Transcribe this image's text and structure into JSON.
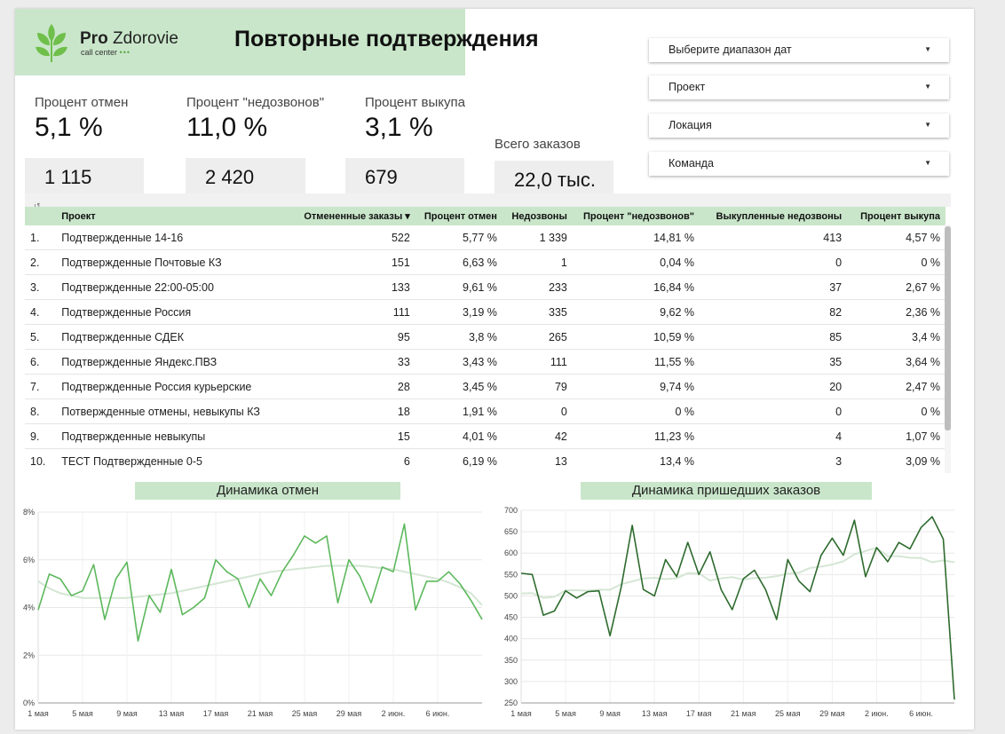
{
  "header": {
    "logo_word_bold": "Pro",
    "logo_word_light": "Zdorovie",
    "logo_sub": "call center",
    "logo_dots": "•••",
    "title": "Повторные подтверждения"
  },
  "filters": [
    {
      "label": "Выберите диапазон дат"
    },
    {
      "label": "Проект"
    },
    {
      "label": "Локация"
    },
    {
      "label": "Команда"
    }
  ],
  "kpis": {
    "cancel": {
      "label": "Процент отмен",
      "value": "5,1 %",
      "count": "1 115"
    },
    "nocall": {
      "label": "Процент \"недозвонов\"",
      "value": "11,0 %",
      "count": "2 420"
    },
    "buyout": {
      "label": "Процент выкупа",
      "value": "3,1 %",
      "count": "679"
    },
    "total": {
      "label": "Всего заказов",
      "value": "22,0 тыс."
    }
  },
  "table": {
    "headers": [
      "",
      "Проект",
      "Отмененные заказы ▾",
      "Процент отмен",
      "Недозвоны",
      "Процент \"недозвонов\"",
      "Выкупленные недозвоны",
      "Процент выкупа"
    ],
    "rows": [
      [
        "1.",
        "Подтвержденные 14-16",
        "522",
        "5,77 %",
        "1 339",
        "14,81 %",
        "413",
        "4,57 %"
      ],
      [
        "2.",
        "Подтвержденные Почтовые КЗ",
        "151",
        "6,63 %",
        "1",
        "0,04 %",
        "0",
        "0 %"
      ],
      [
        "3.",
        "Подтвержденные 22:00-05:00",
        "133",
        "9,61 %",
        "233",
        "16,84 %",
        "37",
        "2,67 %"
      ],
      [
        "4.",
        "Подтвержденные Россия",
        "111",
        "3,19 %",
        "335",
        "9,62 %",
        "82",
        "2,36 %"
      ],
      [
        "5.",
        "Подтвержденные СДЕК",
        "95",
        "3,8 %",
        "265",
        "10,59 %",
        "85",
        "3,4 %"
      ],
      [
        "6.",
        "Подтвержденные Яндекс.ПВЗ",
        "33",
        "3,43 %",
        "111",
        "11,55 %",
        "35",
        "3,64 %"
      ],
      [
        "7.",
        "Подтвержденные Россия курьерские",
        "28",
        "3,45 %",
        "79",
        "9,74 %",
        "20",
        "2,47 %"
      ],
      [
        "8.",
        "Потвержденные отмены, невыкупы КЗ",
        "18",
        "1,91 %",
        "0",
        "0 %",
        "0",
        "0 %"
      ],
      [
        "9.",
        "Подтвержденные невыкупы",
        "15",
        "4,01 %",
        "42",
        "11,23 %",
        "4",
        "1,07 %"
      ],
      [
        "10.",
        "ТЕСТ Подтвержденные 0-5",
        "6",
        "6,19 %",
        "13",
        "13,4 %",
        "3",
        "3,09 %"
      ]
    ]
  },
  "chart_data": [
    {
      "type": "line",
      "title": "Динамика отмен",
      "x_tick_labels": [
        "1 мая",
        "5 мая",
        "9 мая",
        "13 мая",
        "17 мая",
        "21 мая",
        "25 мая",
        "29 мая",
        "2 июн.",
        "6 июн."
      ],
      "y_tick_labels": [
        "0%",
        "2%",
        "4%",
        "6%",
        "8%"
      ],
      "ylim": [
        0,
        8
      ],
      "grid": true,
      "color": "#5cb85c",
      "trend_color": "#d4e6d4",
      "values": [
        3.9,
        5.4,
        5.2,
        4.5,
        4.7,
        5.8,
        3.5,
        5.2,
        5.9,
        2.6,
        4.5,
        3.8,
        5.6,
        3.7,
        4.0,
        4.4,
        6.0,
        5.5,
        5.2,
        4.0,
        5.2,
        4.5,
        5.5,
        6.2,
        7.0,
        6.7,
        7.0,
        4.2,
        6.0,
        5.3,
        4.2,
        5.7,
        5.5,
        7.5,
        3.9,
        5.1,
        5.1,
        5.5,
        5.0,
        4.3,
        3.5
      ],
      "trend": [
        5.1,
        4.8,
        4.6,
        4.5,
        4.4,
        4.4,
        4.4,
        4.4,
        4.4,
        4.45,
        4.5,
        4.55,
        4.6,
        4.7,
        4.8,
        4.9,
        5.0,
        5.1,
        5.2,
        5.3,
        5.4,
        5.5,
        5.55,
        5.6,
        5.65,
        5.7,
        5.75,
        5.75,
        5.75,
        5.75,
        5.7,
        5.65,
        5.6,
        5.5,
        5.4,
        5.3,
        5.2,
        5.05,
        4.85,
        4.6,
        4.1
      ]
    },
    {
      "type": "line",
      "title": "Динамика пришедших заказов",
      "x_tick_labels": [
        "1 мая",
        "5 мая",
        "9 мая",
        "13 мая",
        "17 мая",
        "21 мая",
        "25 мая",
        "29 мая",
        "2 июн.",
        "6 июн."
      ],
      "y_tick_labels": [
        "250",
        "300",
        "350",
        "400",
        "450",
        "500",
        "550",
        "600",
        "650",
        "700"
      ],
      "ylim": [
        250,
        700
      ],
      "grid": true,
      "color": "#2e6b2e",
      "trend_color": "#d4e6d4",
      "values": [
        553,
        550,
        455,
        465,
        512,
        495,
        510,
        512,
        407,
        520,
        665,
        515,
        500,
        585,
        545,
        625,
        550,
        603,
        515,
        468,
        540,
        560,
        515,
        445,
        585,
        535,
        510,
        595,
        635,
        595,
        677,
        545,
        613,
        580,
        625,
        610,
        660,
        685,
        633,
        258
      ]
    }
  ]
}
